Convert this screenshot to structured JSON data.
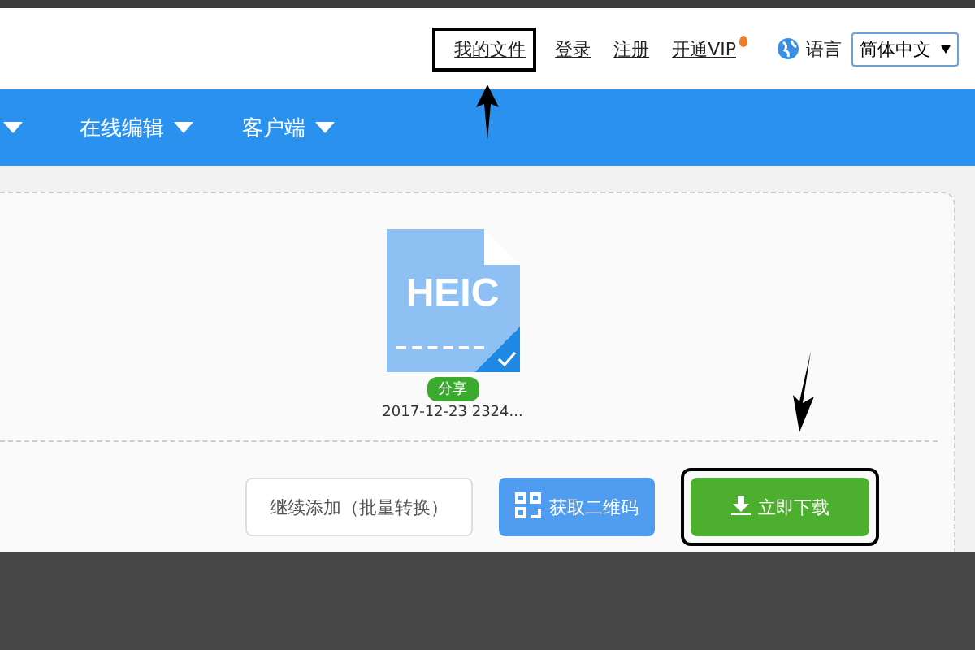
{
  "header": {
    "links": [
      {
        "label": "我的文件",
        "highlighted": true
      },
      {
        "label": "登录",
        "highlighted": false
      },
      {
        "label": "注册",
        "highlighted": false
      },
      {
        "label": "开通VIP",
        "highlighted": false,
        "badge": true
      }
    ],
    "language_label": "语言",
    "language_select": {
      "value": "简体中文"
    }
  },
  "nav": {
    "items": [
      {
        "label": "在线编辑"
      },
      {
        "label": "客户端"
      }
    ]
  },
  "file": {
    "type_label": "HEIC",
    "checked": true,
    "share_badge": "分享",
    "name": "2017-12-23 2324..."
  },
  "buttons": [
    {
      "kind": "outline",
      "label": "继续添加（批量转换）"
    },
    {
      "kind": "qr",
      "label": "获取二维码"
    },
    {
      "kind": "download",
      "label": "立即下载",
      "highlighted": true
    }
  ]
}
